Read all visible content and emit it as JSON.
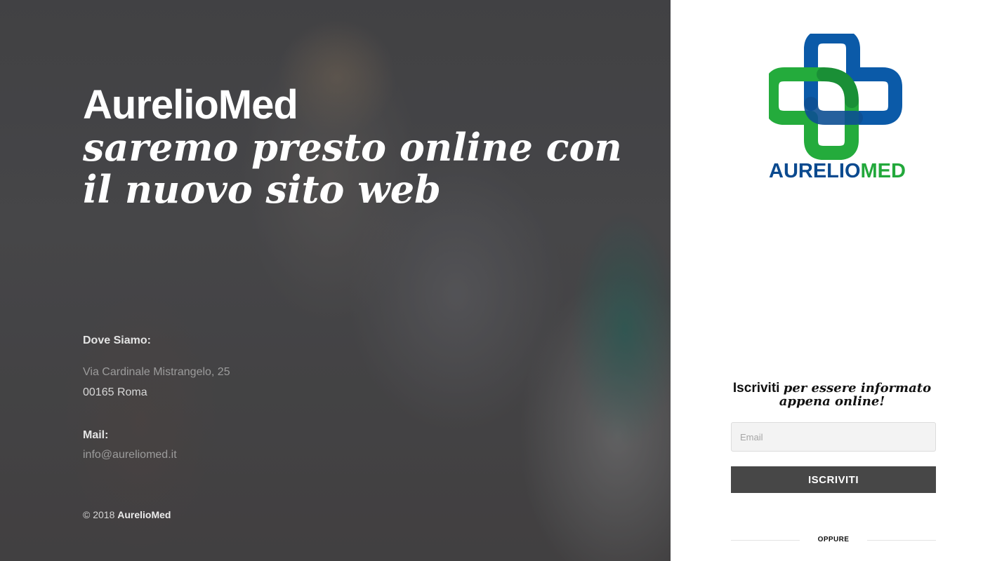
{
  "hero": {
    "brand": "AurelioMed",
    "tagline": "saremo presto online con il nuovo sito web",
    "location_title": "Dove Siamo:",
    "address_line1": "Via Cardinale Mistrangelo, 25",
    "address_line2": "00165 Roma",
    "mail_title": "Mail:",
    "mail_value": "info@aureliomed.it",
    "copyright_prefix": "© 2018",
    "copyright_brand": "AurelioMed"
  },
  "logo": {
    "text_part1": "AURELIO",
    "text_part2": "MED",
    "icon": "medical-cross-logo-icon",
    "colors": {
      "blue": "#0b4f9c",
      "green": "#22a83b"
    }
  },
  "subscribe": {
    "title_strong": "Iscriviti",
    "title_em": "per essere informato appena online!",
    "email_placeholder": "Email",
    "button_label": "ISCRIVITI",
    "divider_label": "OPPURE"
  },
  "colors": {
    "button_bg": "#474747",
    "input_bg": "#f3f3f3",
    "hero_overlay": "#4b4b4d"
  }
}
